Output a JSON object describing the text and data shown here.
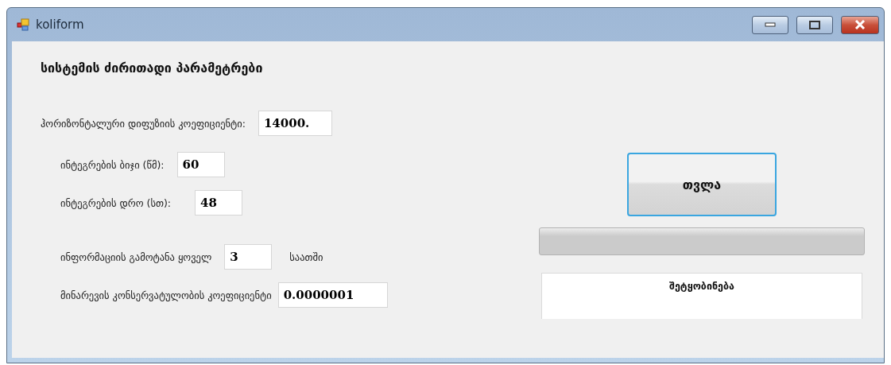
{
  "window": {
    "title": "koliform"
  },
  "heading": "სისტემის ძირითადი პარამეტრები",
  "fields": [
    {
      "label": "ჰორიზონტალური დიფუზიის კოეფიციენტი:",
      "value": "14000."
    },
    {
      "label": "ინტეგრების ბიჯი (წმ):",
      "value": "60"
    },
    {
      "label": "ინტეგრების დრო (სთ):",
      "value": "48"
    },
    {
      "label": "ინფორმაციის გამოტანა ყოველ",
      "value": "3",
      "suffix": "საათში"
    },
    {
      "label": "მინარევის კონსერვატულობის კოეფიციენტი",
      "value": "0.0000001"
    }
  ],
  "compute_button": "თვლა",
  "progress": {
    "level": 0
  },
  "message_box": {
    "text": "შეტყობინება"
  }
}
